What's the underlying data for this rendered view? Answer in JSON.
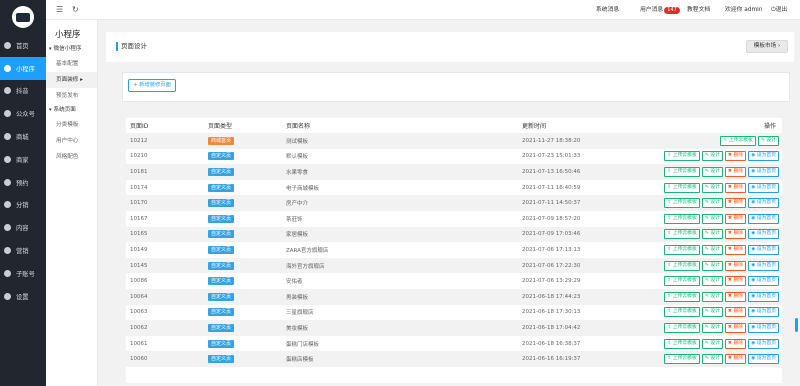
{
  "nav": {
    "items": [
      {
        "label": "首页",
        "icon": "home-icon",
        "active": false
      },
      {
        "label": "小程序",
        "icon": "miniapp-icon",
        "active": true
      },
      {
        "label": "抖音",
        "icon": "douyin-icon",
        "active": false
      },
      {
        "label": "公众号",
        "icon": "wechat-icon",
        "active": false
      },
      {
        "label": "商城",
        "icon": "shop-icon",
        "active": false
      },
      {
        "label": "商家",
        "icon": "merchant-icon",
        "active": false
      },
      {
        "label": "预约",
        "icon": "calendar-icon",
        "active": false
      },
      {
        "label": "分销",
        "icon": "share-icon",
        "active": false
      },
      {
        "label": "内容",
        "icon": "content-icon",
        "active": false
      },
      {
        "label": "营销",
        "icon": "marketing-icon",
        "active": false
      },
      {
        "label": "子账号",
        "icon": "user-icon",
        "active": false
      },
      {
        "label": "设置",
        "icon": "gear-icon",
        "active": false
      }
    ]
  },
  "sub": {
    "title": "小程序",
    "groups": [
      {
        "label": "微信小程序",
        "items": [
          {
            "label": "基本配置",
            "active": false
          },
          {
            "label": "页面装修",
            "active": true
          },
          {
            "label": "预览发布",
            "active": false
          }
        ]
      },
      {
        "label": "系统页面",
        "items": [
          {
            "label": "分类模板",
            "active": false
          },
          {
            "label": "用户中心",
            "active": false
          },
          {
            "label": "风格配色",
            "active": false
          }
        ]
      }
    ]
  },
  "topbar": {
    "menu_icon": "menu-icon",
    "refresh_icon": "refresh-icon",
    "sys_msg": "系统消息",
    "user_msg": "用户消息",
    "user_msg_count": "147",
    "tutorial": "教程文档",
    "welcome": "欢迎你 admin",
    "logout": "退出"
  },
  "page": {
    "title": "页面设计",
    "market_btn": "模板市场",
    "new_btn": "新增装修页面"
  },
  "table": {
    "columns": [
      "页面ID",
      "页面类型",
      "页面名称",
      "更新时间",
      "操作"
    ],
    "op_labels": {
      "upload": "上传云模板",
      "design": "设计",
      "delete": "删除",
      "set_home": "设为首页"
    },
    "colors": {
      "shop_home": "#f0883a",
      "custom": "#36a3e0",
      "primary": "#1e9fff",
      "success": "#16b777",
      "danger": "#ff5722"
    },
    "rows": [
      {
        "id": "10212",
        "type": "商城首页",
        "name": "测试模板",
        "time": "2021-11-27 18:38:20",
        "home": true
      },
      {
        "id": "10210",
        "type": "自定义页",
        "name": "默认模板",
        "time": "2021-07-23 15:01:33",
        "home": false
      },
      {
        "id": "10181",
        "type": "自定义页",
        "name": "水果零食",
        "time": "2021-07-13 16:50:46",
        "home": false
      },
      {
        "id": "10174",
        "type": "自定义页",
        "name": "电子商城模板",
        "time": "2021-07-11 16:40:59",
        "home": false
      },
      {
        "id": "10170",
        "type": "自定义页",
        "name": "房产中介",
        "time": "2021-07-11 14:50:37",
        "home": false
      },
      {
        "id": "10167",
        "type": "自定义页",
        "name": "茶莊饰",
        "time": "2021-07-09 18:57:20",
        "home": false
      },
      {
        "id": "10165",
        "type": "自定义页",
        "name": "家居模板",
        "time": "2021-07-09 17:03:46",
        "home": false
      },
      {
        "id": "10149",
        "type": "自定义页",
        "name": "ZARA官方旗舰店",
        "time": "2021-07-06 17:13:13",
        "home": false
      },
      {
        "id": "10145",
        "type": "自定义页",
        "name": "海外官方旗舰店",
        "time": "2021-07-06 17:22:30",
        "home": false
      },
      {
        "id": "10086",
        "type": "自定义页",
        "name": "安佑者",
        "time": "2021-07-06 13:29:29",
        "home": false
      },
      {
        "id": "10064",
        "type": "自定义页",
        "name": "男装模板",
        "time": "2021-06-18 17:44:23",
        "home": false
      },
      {
        "id": "10063",
        "type": "自定义页",
        "name": "三星旗舰店",
        "time": "2021-06-18 17:30:13",
        "home": false
      },
      {
        "id": "10062",
        "type": "自定义页",
        "name": "美妆模板",
        "time": "2021-06-18 17:04:42",
        "home": false
      },
      {
        "id": "10061",
        "type": "自定义页",
        "name": "蛋糕门店模板",
        "time": "2021-06-18 16:38:37",
        "home": false
      },
      {
        "id": "10060",
        "type": "自定义页",
        "name": "蛋糕店模板",
        "time": "2021-06-16 16:19:37",
        "home": false
      },
      {
        "id": "",
        "type": "",
        "name": "",
        "time": "",
        "home": false
      }
    ]
  }
}
